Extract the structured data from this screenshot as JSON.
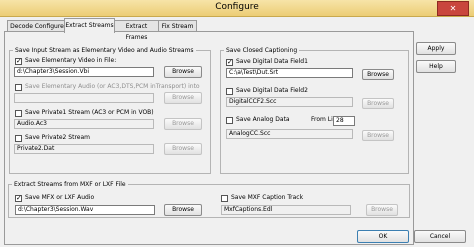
{
  "window": {
    "title": "Configure",
    "close_glyph": "✕"
  },
  "tabs": [
    {
      "label": "Decode Configure"
    },
    {
      "label": "Extract Streams"
    },
    {
      "label": "Extract Frames"
    },
    {
      "label": "Fix Stream"
    }
  ],
  "left_group": {
    "title": "Save Input Stream as Elementary Video and Audio Streams",
    "elem_video": {
      "label": "Save Elementary Video in File:",
      "value": "d:\\Chapter3\\Session.Vbi",
      "browse": "Browse"
    },
    "elem_audio": {
      "label": "Save Elementary Audio (or AC3,DTS,PCM inTransport) into",
      "value": "",
      "browse": "Browse"
    },
    "private1": {
      "label": "Save Private1 Stream (AC3 or PCM in VOB)",
      "value": "Audio.Ac3",
      "browse": "Browse"
    },
    "private2": {
      "label": "Save Private2 Stream",
      "value": "Private2.Dat",
      "browse": "Browse"
    }
  },
  "cc_group": {
    "title": "Save Closed Captioning",
    "field1": {
      "label": "Save Digital Data Field1",
      "value": "C:\\a\\Test\\Dut.Srt",
      "browse": "Browse"
    },
    "field2": {
      "label": "Save Digital Data Field2",
      "value": "DigitalCCF2.Scc",
      "browse": "Browse"
    },
    "analog": {
      "label": "Save Analog Data",
      "from_line_label": "From Line:",
      "from_line": "28",
      "value": "AnalogCC.Scc",
      "browse": "Browse"
    }
  },
  "mxf_group": {
    "title": "Extract Streams from MXF or LXF File",
    "audio": {
      "label": "Save MFX or LXF Audio",
      "value": "d:\\Chapter3\\Session.Wav",
      "browse": "Browse"
    },
    "caption": {
      "label": "Save MXF Caption Track",
      "value": "MxfCaptions.Edl",
      "browse": "Browse"
    }
  },
  "buttons": {
    "apply": "Apply",
    "help": "Help",
    "ok": "OK",
    "cancel": "Cancel"
  }
}
